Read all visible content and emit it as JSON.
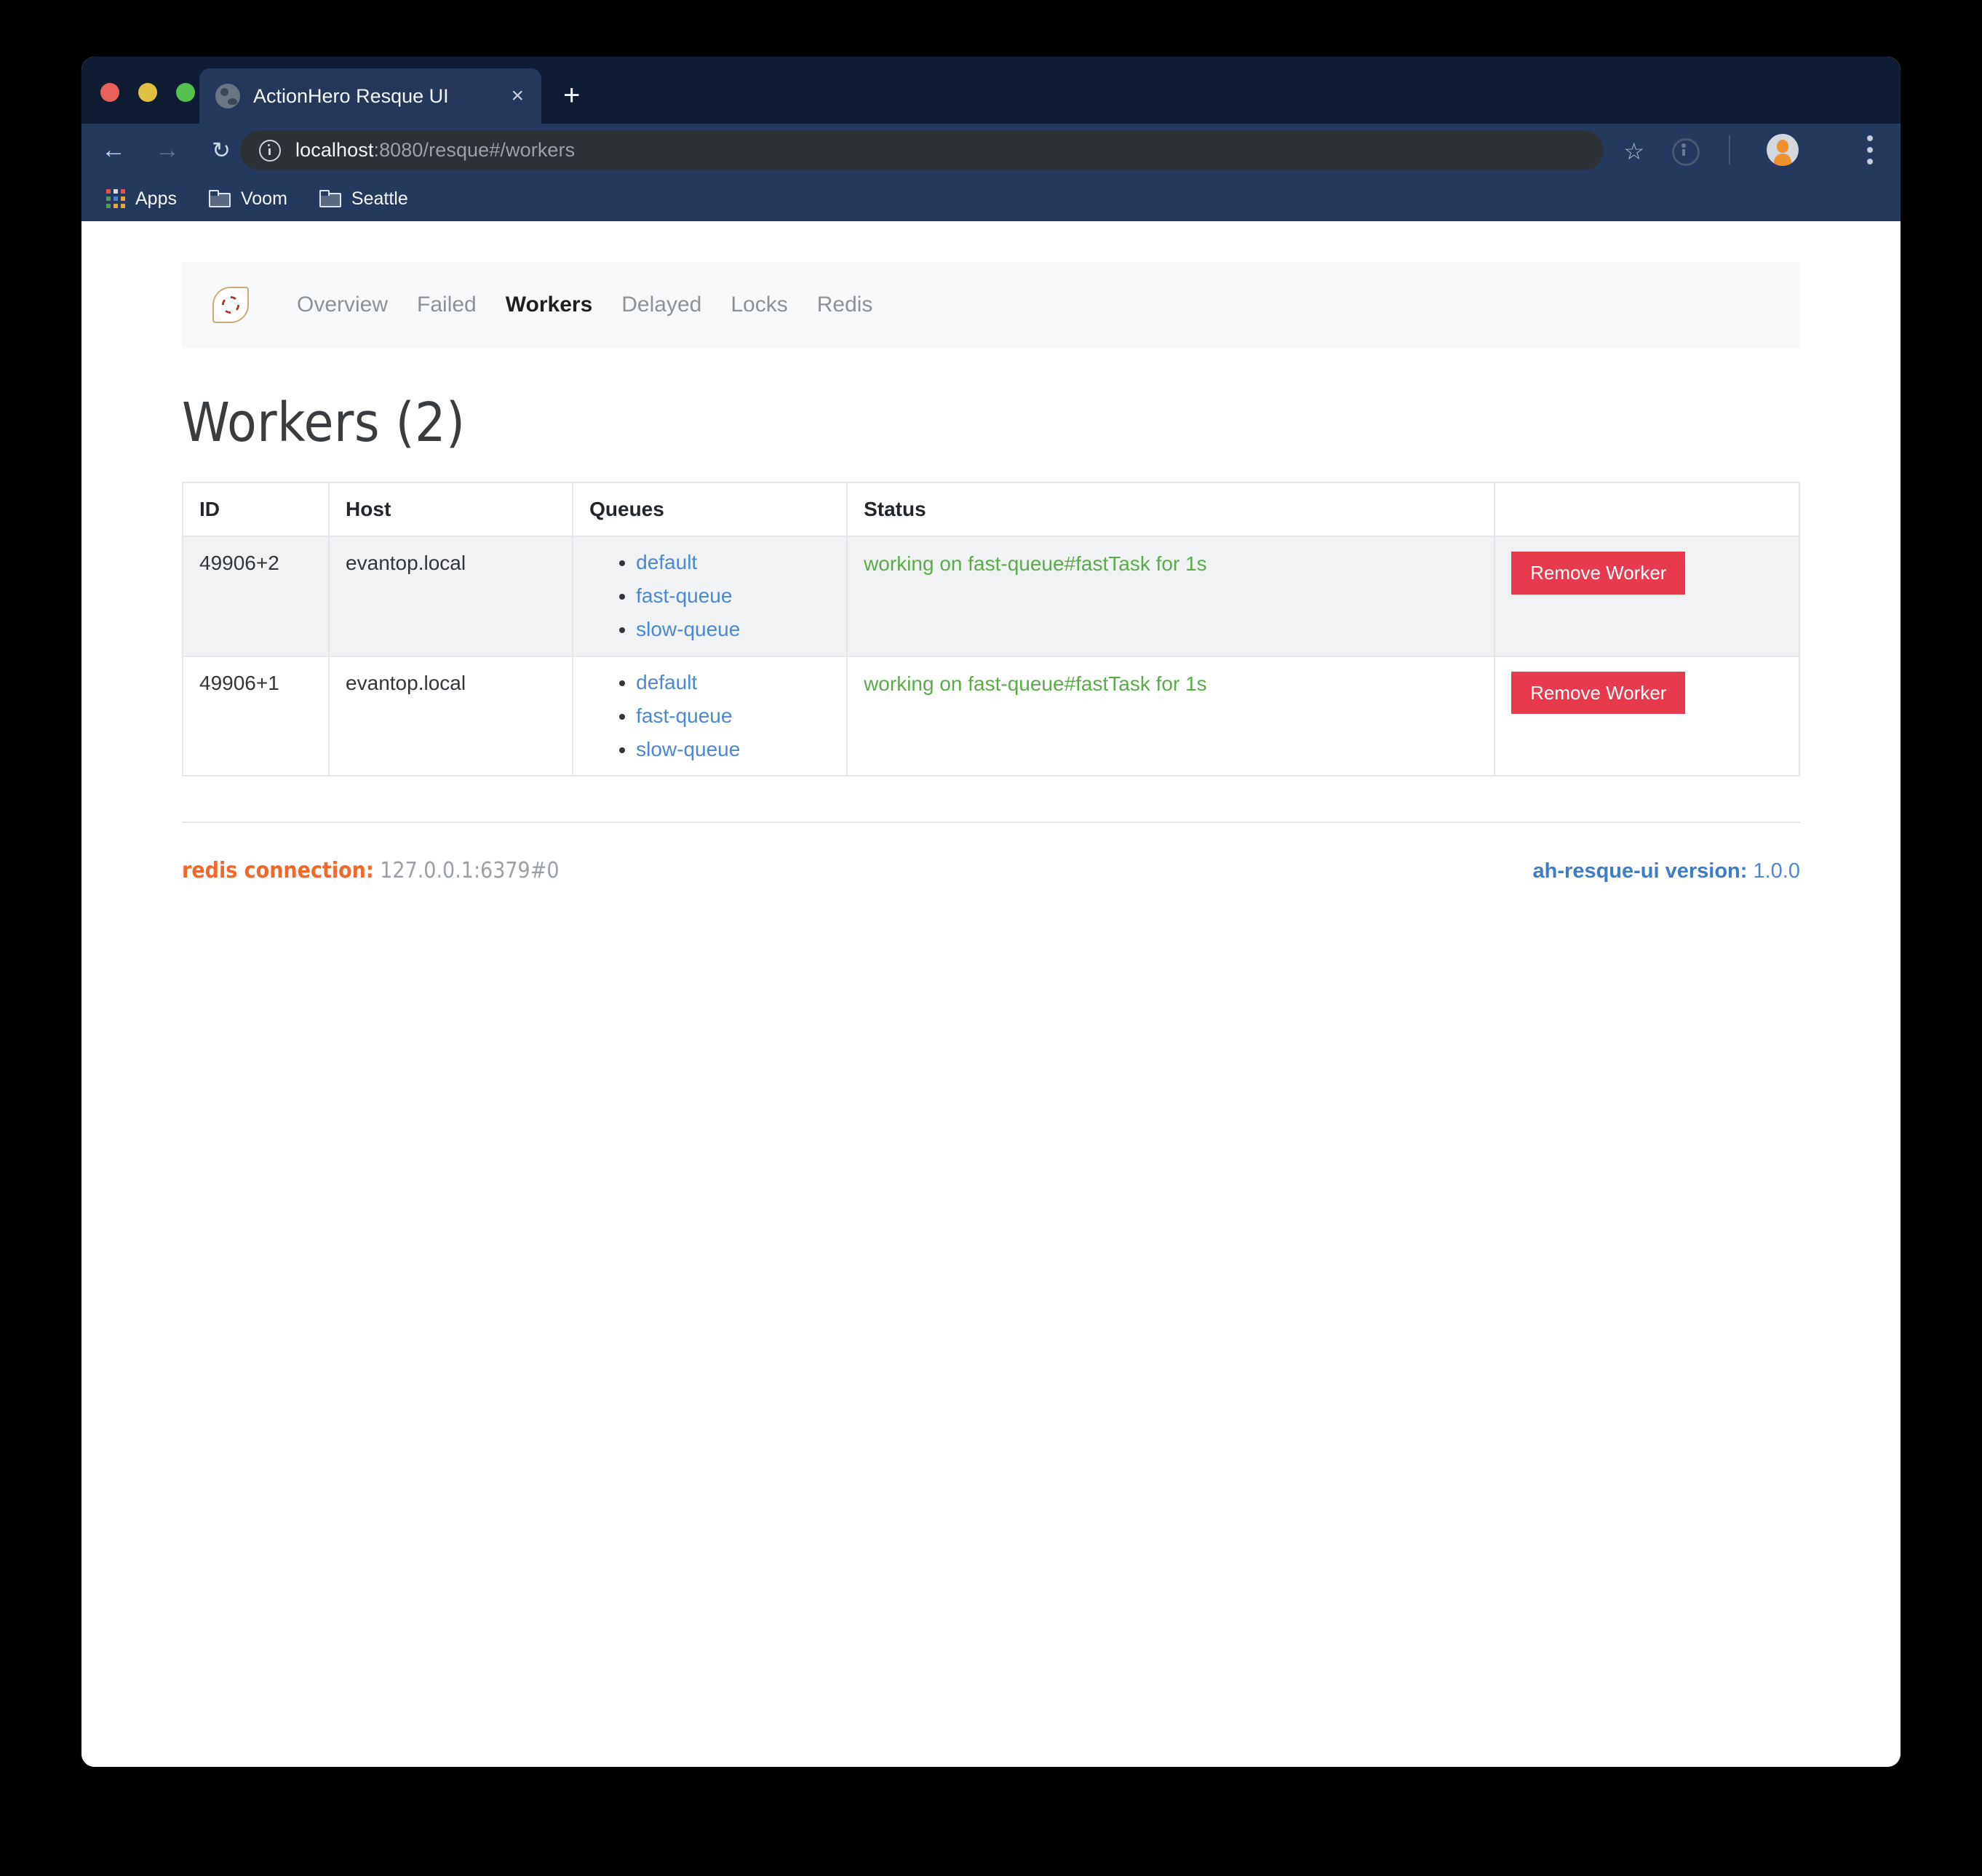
{
  "browser": {
    "tab": {
      "title": "ActionHero Resque UI",
      "favicon": "globe-icon",
      "close_label": "×"
    },
    "new_tab_label": "+",
    "nav": {
      "back": "←",
      "forward": "→",
      "reload": "↻"
    },
    "url": {
      "host": "localhost",
      "rest": ":8080/resque#/workers",
      "security_icon": "info-circle-icon"
    },
    "toolbar_icons": {
      "bookmark": "☆",
      "extension": "extension-info-icon",
      "avatar": "user-avatar",
      "menu": "kebab-menu-icon"
    },
    "bookmarks": [
      {
        "label": "Apps",
        "icon": "apps-grid-icon"
      },
      {
        "label": "Voom",
        "icon": "folder-icon"
      },
      {
        "label": "Seattle",
        "icon": "folder-icon"
      }
    ]
  },
  "app": {
    "logo": "lifebuoy-icon",
    "nav_links": [
      {
        "label": "Overview",
        "active": false
      },
      {
        "label": "Failed",
        "active": false
      },
      {
        "label": "Workers",
        "active": true
      },
      {
        "label": "Delayed",
        "active": false
      },
      {
        "label": "Locks",
        "active": false
      },
      {
        "label": "Redis",
        "active": false
      }
    ],
    "page_title": "Workers (2)",
    "table": {
      "headers": [
        "ID",
        "Host",
        "Queues",
        "Status",
        ""
      ],
      "rows": [
        {
          "id": "49906+2",
          "host": "evantop.local",
          "queues": [
            "default",
            "fast-queue",
            "slow-queue"
          ],
          "status": "working on fast-queue#fastTask for 1s",
          "action_label": "Remove Worker"
        },
        {
          "id": "49906+1",
          "host": "evantop.local",
          "queues": [
            "default",
            "fast-queue",
            "slow-queue"
          ],
          "status": "working on fast-queue#fastTask for 1s",
          "action_label": "Remove Worker"
        }
      ]
    },
    "footer": {
      "redis_label": "redis connection:",
      "redis_value": "127.0.0.1:6379#0",
      "version_label": "ah-resque-ui version:",
      "version_value": "1.0.0"
    }
  },
  "colors": {
    "accent_red": "#e73a4c",
    "link_blue": "#4c88d1",
    "status_green": "#5aac4a",
    "redis_orange": "#f2682a",
    "chrome_navy": "#25395e",
    "titlebar_navy": "#101c33"
  }
}
